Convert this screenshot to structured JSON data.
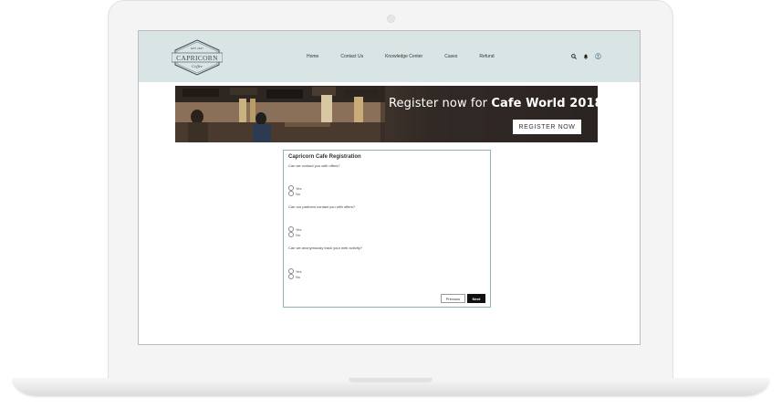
{
  "logo": {
    "top_text": "EST. 2017",
    "main_text": "CAPRICORN",
    "sub_text": "Coffee"
  },
  "nav": {
    "items": [
      "Home",
      "Contact Us",
      "Knowledge Center",
      "Cases",
      "Refund"
    ]
  },
  "header_icons": [
    "search-icon",
    "bell-icon",
    "avatar-icon"
  ],
  "banner": {
    "title_prefix": "Register now for ",
    "title_bold": "Cafe World 2018",
    "button_label": "REGISTER NOW"
  },
  "form": {
    "title": "Capricorn Cafe Registration",
    "questions": [
      {
        "text": "Can we contact you with offers?",
        "options": [
          "Yes",
          "No"
        ]
      },
      {
        "text": "Can our partners contact you with offers?",
        "options": [
          "Yes",
          "No"
        ]
      },
      {
        "text": "Can we anonymously track your web activity?",
        "options": [
          "Yes",
          "No"
        ]
      }
    ],
    "previous_label": "Previous",
    "next_label": "Next"
  },
  "colors": {
    "header_bg": "#d9e5e5",
    "card_border": "#8fb3b8",
    "next_button": "#111111"
  }
}
